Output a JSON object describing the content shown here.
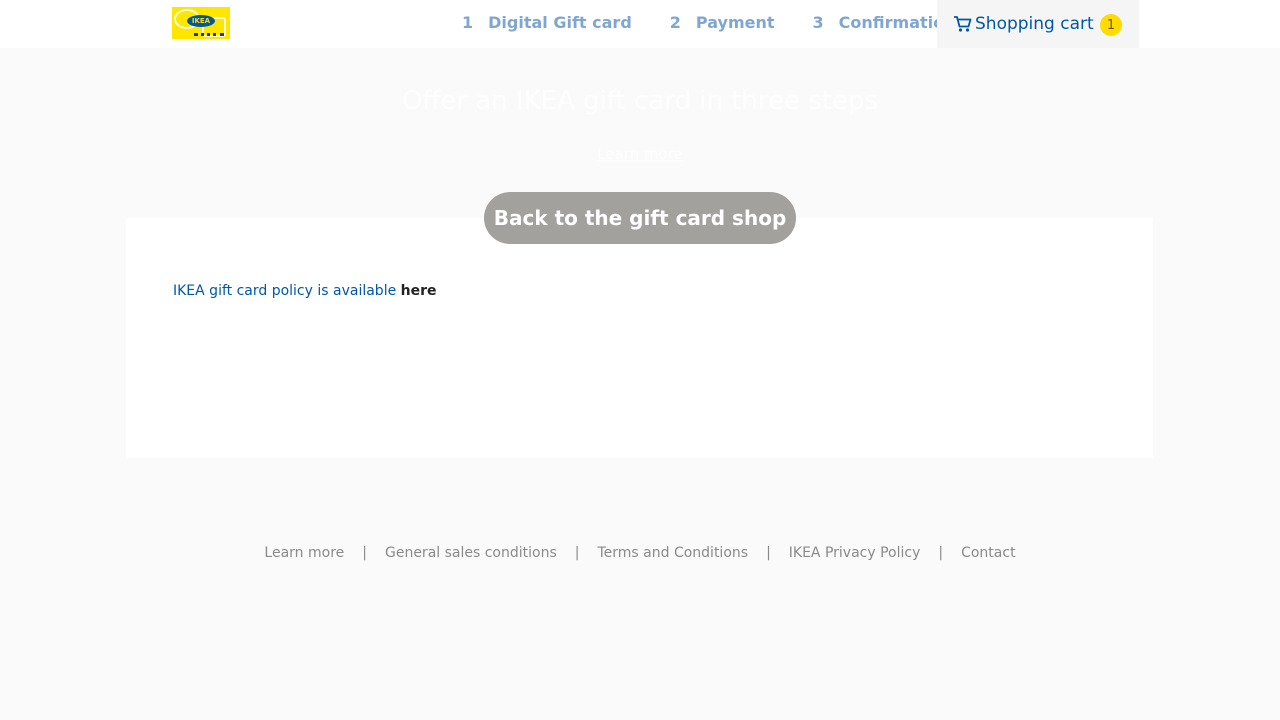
{
  "header": {
    "logo_text": "IKEA",
    "steps": [
      {
        "number": "1",
        "label": "Digital Gift card"
      },
      {
        "number": "2",
        "label": "Payment"
      },
      {
        "number": "3",
        "label": "Confirmation"
      }
    ],
    "cart": {
      "label": "Shopping cart",
      "count": "1",
      "icon": "cart-icon"
    }
  },
  "hero": {
    "title": "Offer an IKEA gift card in three steps",
    "learn_more": "Learn more"
  },
  "main": {
    "back_button": "Back to the gift card shop",
    "policy_text": "IKEA gift card policy is available ",
    "policy_link": "here"
  },
  "footer": {
    "links": [
      "Learn more",
      "General sales conditions",
      "Terms and Conditions",
      "IKEA Privacy Policy",
      "Contact"
    ],
    "separator": "|"
  },
  "colors": {
    "brand_blue": "#0058a3",
    "brand_yellow": "#ffdb00",
    "step_text": "#7fa6d3",
    "button_bg": "#a3a19d",
    "page_bg": "#fafafa"
  }
}
